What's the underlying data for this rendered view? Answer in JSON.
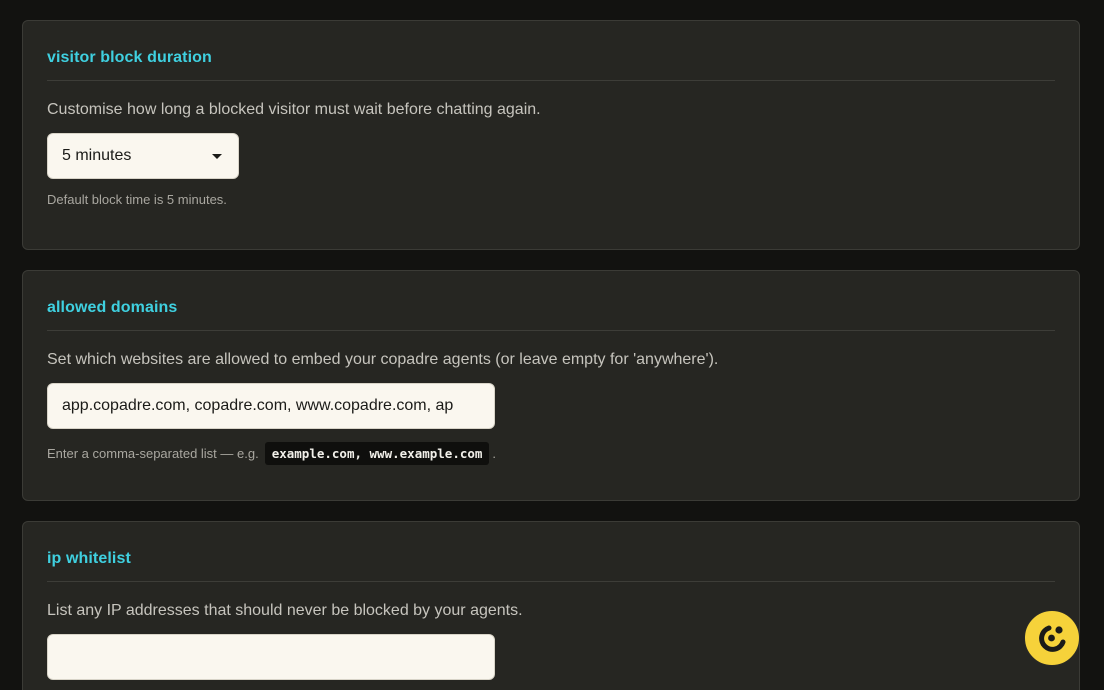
{
  "sections": [
    {
      "title": "visitor block duration",
      "description": "Customise how long a blocked visitor must wait before chatting again.",
      "select_value": "5 minutes",
      "help_text": "Default block time is 5 minutes."
    },
    {
      "title": "allowed domains",
      "description": "Set which websites are allowed to embed your copadre agents (or leave empty for 'anywhere').",
      "input_value": "app.copadre.com, copadre.com, www.copadre.com, ap",
      "help_prefix": "Enter a comma-separated list — e.g.",
      "help_code": "example.com, www.example.com",
      "help_suffix": "."
    },
    {
      "title": "ip whitelist",
      "description": "List any IP addresses that should never be blocked by your agents.",
      "input_value": ""
    }
  ],
  "fab": {
    "icon": "chat-assistant-icon",
    "color": "#f6d23a"
  },
  "colors": {
    "accent": "#3fd0e0",
    "card_bg": "#262622",
    "page_bg": "#121210"
  }
}
